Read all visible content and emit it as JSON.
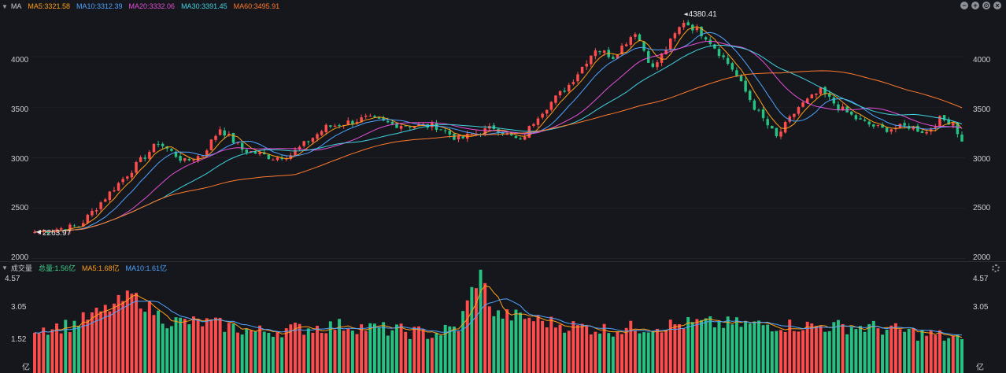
{
  "main_legend": {
    "title": "MA",
    "items": [
      {
        "label": "MA5:3321.58",
        "color": "#ff9f1a"
      },
      {
        "label": "MA10:3312.39",
        "color": "#4ea3ff"
      },
      {
        "label": "MA20:3332.06",
        "color": "#e34fd6"
      },
      {
        "label": "MA30:3391.45",
        "color": "#3fd2e0"
      },
      {
        "label": "MA60:3495.91",
        "color": "#ff7a2e"
      }
    ]
  },
  "volume_legend": {
    "title": "成交量",
    "items": [
      {
        "label": "总量:1.56亿",
        "color": "#3fd28a"
      },
      {
        "label": "MA5:1.68亿",
        "color": "#ff9f1a"
      },
      {
        "label": "MA10:1.61亿",
        "color": "#4ea3ff"
      }
    ]
  },
  "controls": [
    "−",
    "+",
    "⊙",
    "×"
  ],
  "colors": {
    "up": "#ff4d4d",
    "down": "#26c281",
    "grid": "#26282f"
  },
  "chart_data": [
    {
      "type": "candlestick",
      "ylim": [
        1990,
        4420
      ],
      "y_ticks": [
        "2000",
        "2500",
        "3000",
        "3500",
        "4000"
      ],
      "annotations": {
        "high": "4380.41",
        "low": "2263.97"
      },
      "anchors": [
        [
          0,
          2264
        ],
        [
          6,
          2300
        ],
        [
          10,
          2320
        ],
        [
          18,
          2700
        ],
        [
          28,
          3150
        ],
        [
          34,
          2960
        ],
        [
          38,
          3030
        ],
        [
          42,
          3290
        ],
        [
          47,
          3080
        ],
        [
          54,
          3000
        ],
        [
          58,
          3030
        ],
        [
          66,
          3300
        ],
        [
          75,
          3390
        ],
        [
          81,
          3330
        ],
        [
          91,
          3310
        ],
        [
          96,
          3180
        ],
        [
          104,
          3300
        ],
        [
          110,
          3160
        ],
        [
          114,
          3420
        ],
        [
          121,
          3720
        ],
        [
          127,
          4080
        ],
        [
          131,
          4000
        ],
        [
          136,
          4250
        ],
        [
          140,
          3880
        ],
        [
          147,
          4350
        ],
        [
          152,
          4200
        ],
        [
          158,
          3880
        ],
        [
          163,
          3500
        ],
        [
          168,
          3200
        ],
        [
          173,
          3500
        ],
        [
          178,
          3660
        ],
        [
          182,
          3500
        ],
        [
          187,
          3360
        ],
        [
          192,
          3280
        ],
        [
          196,
          3300
        ],
        [
          198,
          3310
        ],
        [
          202,
          3250
        ],
        [
          205,
          3380
        ],
        [
          208,
          3350
        ],
        [
          210,
          3160
        ]
      ]
    },
    {
      "type": "bar",
      "ylim": [
        0,
        4.57
      ],
      "y_ticks": [
        "4.57",
        "3.05",
        "1.52",
        "亿"
      ],
      "anchors": [
        [
          0,
          2.05
        ],
        [
          8,
          2.2
        ],
        [
          16,
          2.9
        ],
        [
          22,
          3.6
        ],
        [
          30,
          2.4
        ],
        [
          40,
          2.3
        ],
        [
          50,
          1.9
        ],
        [
          60,
          2.05
        ],
        [
          70,
          2.2
        ],
        [
          80,
          2.0
        ],
        [
          90,
          1.8
        ],
        [
          96,
          2.1
        ],
        [
          99,
          3.8
        ],
        [
          101,
          4.57
        ],
        [
          104,
          2.7
        ],
        [
          110,
          2.6
        ],
        [
          120,
          2.2
        ],
        [
          130,
          2.0
        ],
        [
          150,
          2.3
        ],
        [
          170,
          2.2
        ],
        [
          190,
          2.1
        ],
        [
          210,
          1.56
        ]
      ]
    }
  ]
}
